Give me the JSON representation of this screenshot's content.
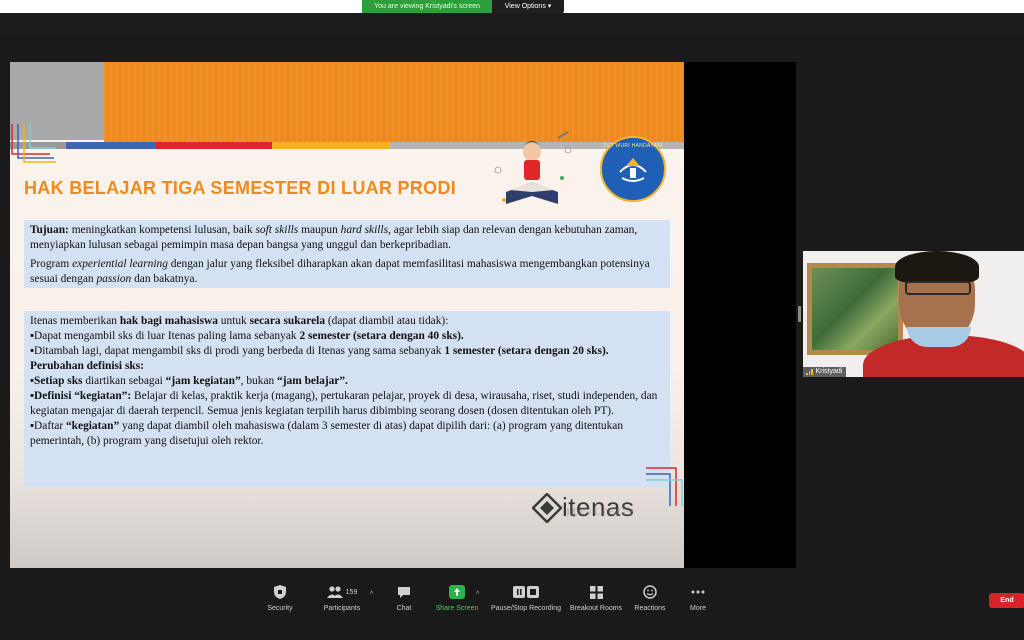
{
  "banner": {
    "viewing_text": "You are viewing Kristyadi's screen",
    "view_options": "View Options"
  },
  "slide": {
    "title": "HAK BELAJAR TIGA SEMESTER DI LUAR PRODI",
    "logo_text": "TUT WURI HANDAYANI",
    "brand": "itenas",
    "box1": {
      "tujuan_label": "Tujuan:",
      "tujuan_text_1": " meningkatkan kompetensi lulusan, baik ",
      "soft_skills": "soft skills",
      "tujuan_text_2": " maupun ",
      "hard_skills": "hard skills",
      "tujuan_text_3": ", agar lebih siap dan relevan dengan kebutuhan zaman, menyiapkan lulusan sebagai pemimpin masa depan bangsa yang unggul dan berkepribadian.",
      "program_1": "Program ",
      "experiential": "experiential learning",
      "program_2": " dengan jalur yang fleksibel diharapkan akan dapat memfasilitasi mahasiswa mengembangkan potensinya sesuai dengan ",
      "passion": "passion",
      "program_3": " dan bakatnya."
    },
    "box2": {
      "l1_a": "Itenas memberikan ",
      "l1_b": "hak bagi mahasiswa",
      "l1_c": " untuk ",
      "l1_d": "secara sukarela",
      "l1_e": " (dapat diambil  atau tidak):",
      "l2_a": "▪Dapat mengambil sks di luar Itenas paling lama sebanyak ",
      "l2_b": "2 semester (setara dengan 40 sks).",
      "l3_a": "▪Ditambah lagi, dapat mengambil sks di prodi yang berbeda di Itenas yang sama sebanyak ",
      "l3_b": "1  semester (setara dengan 20 sks).",
      "l4": "Perubahan definisi sks:",
      "l5_a": "▪Setiap sks",
      "l5_b": " diartikan sebagai ",
      "l5_c": "“jam kegiatan”",
      "l5_d": ", bukan ",
      "l5_e": "“jam  belajar”.",
      "l6_a": "▪Definisi “kegiatan”:",
      "l6_b": " Belajar di kelas, praktik kerja (magang), pertukaran pelajar, proyek di desa,  wirausaha, riset, studi independen, dan kegiatan mengajar di daerah terpencil. Semua jenis  kegiatan terpilih harus dibimbing seorang dosen (dosen ditentukan oleh PT).",
      "l7_a": "▪Daftar ",
      "l7_b": "“kegiatan”",
      "l7_c": " yang dapat diambil oleh mahasiswa (dalam 3 semester di atas) dapat dipilih  dari: (a) program yang ditentukan pemerintah, (b) program yang disetujui oleh rektor."
    }
  },
  "participant": {
    "name": "Kristyadi"
  },
  "toolbar": {
    "security": "Security",
    "participants": "Participants",
    "participants_count": "159",
    "chat": "Chat",
    "share_screen": "Share Screen",
    "record": "Pause/Stop Recording",
    "breakout": "Breakout Rooms",
    "reactions": "Reactions",
    "more": "More",
    "end": "End"
  },
  "colors": {
    "share_green": "#2e9e3a",
    "slide_orange": "#f08a1e",
    "text_box_blue": "#d3e1f3",
    "end_red": "#d9222a"
  }
}
